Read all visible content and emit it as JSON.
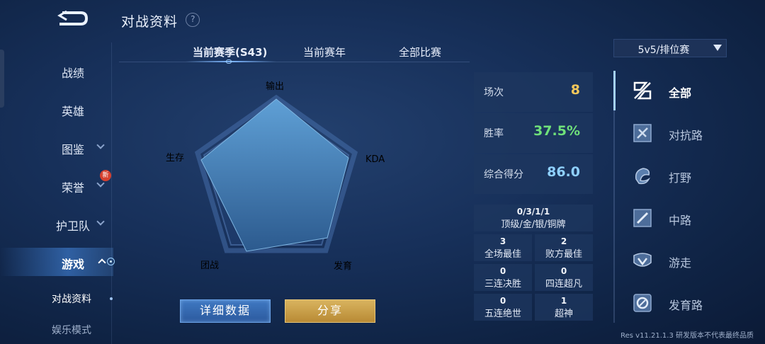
{
  "header": {
    "title": "对战资料",
    "help": "?"
  },
  "sidebar": {
    "items": [
      {
        "label": "战绩"
      },
      {
        "label": "英雄"
      },
      {
        "label": "图鉴"
      },
      {
        "label": "荣誉",
        "badge": "新"
      },
      {
        "label": "护卫队"
      },
      {
        "label": "游戏"
      },
      {
        "label": "对战资料"
      },
      {
        "label": "娱乐模式"
      }
    ]
  },
  "tabs": [
    {
      "label": "当前赛季(S43)"
    },
    {
      "label": "当前赛年"
    },
    {
      "label": "全部比赛"
    }
  ],
  "mode_select": {
    "value": "5v5/排位赛"
  },
  "radar": {
    "labels": {
      "output": "输出",
      "kda": "KDA",
      "development": "发育",
      "teamfight": "团战",
      "survival": "生存"
    }
  },
  "buttons": {
    "detail": "详细数据",
    "share": "分享"
  },
  "stats": {
    "matches": {
      "label": "场次",
      "value": "8"
    },
    "win_rate": {
      "label": "胜率",
      "value": "37.5%"
    },
    "score": {
      "label": "综合得分",
      "value": "86.0"
    }
  },
  "record": {
    "numbers": "0/3/1/1",
    "legend": "顶级/金/银/铜牌"
  },
  "honors": [
    {
      "value": "3",
      "label": "全场最佳"
    },
    {
      "value": "2",
      "label": "败方最佳"
    },
    {
      "value": "0",
      "label": "三连决胜"
    },
    {
      "value": "0",
      "label": "四连超凡"
    },
    {
      "value": "0",
      "label": "五连绝世"
    },
    {
      "value": "1",
      "label": "超神"
    }
  ],
  "roles": [
    {
      "label": "全部",
      "icon": "all-roles-icon"
    },
    {
      "label": "对抗路",
      "icon": "clash-lane-icon"
    },
    {
      "label": "打野",
      "icon": "jungle-icon"
    },
    {
      "label": "中路",
      "icon": "mid-lane-icon"
    },
    {
      "label": "游走",
      "icon": "roam-icon"
    },
    {
      "label": "发育路",
      "icon": "farm-lane-icon"
    }
  ],
  "version": "Res v11.21.1.3 研发版本不代表最终品质",
  "colors": {
    "matches": "#f3c75a",
    "win_rate": "#6fe07a",
    "score": "#8fd0ff"
  }
}
